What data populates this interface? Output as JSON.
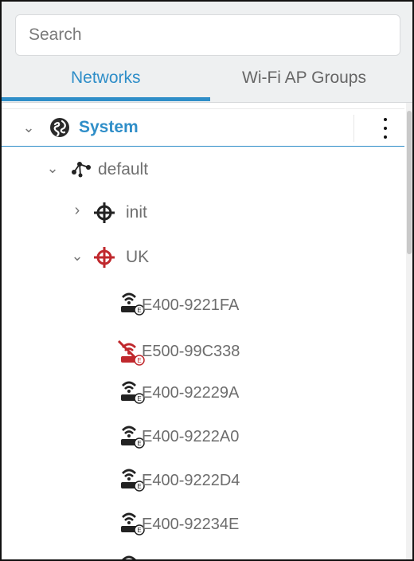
{
  "search": {
    "placeholder": "Search"
  },
  "tabs": [
    {
      "label": "Networks",
      "active": true
    },
    {
      "label": "Wi-Fi AP Groups",
      "active": false
    }
  ],
  "tree": {
    "root": {
      "label": "System",
      "expanded": true,
      "icon": "globe-icon"
    },
    "group": {
      "label": "default",
      "expanded": true,
      "icon": "network-icon"
    },
    "sites": [
      {
        "label": "init",
        "expanded": false,
        "icon": "site-crosshair-icon"
      },
      {
        "label": "UK",
        "expanded": true,
        "icon": "site-crosshair-alert-icon"
      }
    ],
    "devices": [
      {
        "label": "E400-9221FA",
        "status": "online",
        "icon": "access-point-icon"
      },
      {
        "label": "E500-99C338",
        "status": "offline",
        "icon": "access-point-offline-icon"
      },
      {
        "label": "E400-92229A",
        "status": "online",
        "icon": "access-point-icon"
      },
      {
        "label": "E400-9222A0",
        "status": "online",
        "icon": "access-point-icon"
      },
      {
        "label": "E400-9222D4",
        "status": "online",
        "icon": "access-point-icon"
      },
      {
        "label": "E400-92234E",
        "status": "online",
        "icon": "access-point-icon"
      }
    ]
  },
  "colors": {
    "accent": "#2f8ec8",
    "alert": "#c0282d",
    "text": "#6e6e6e",
    "icon": "#222222"
  }
}
